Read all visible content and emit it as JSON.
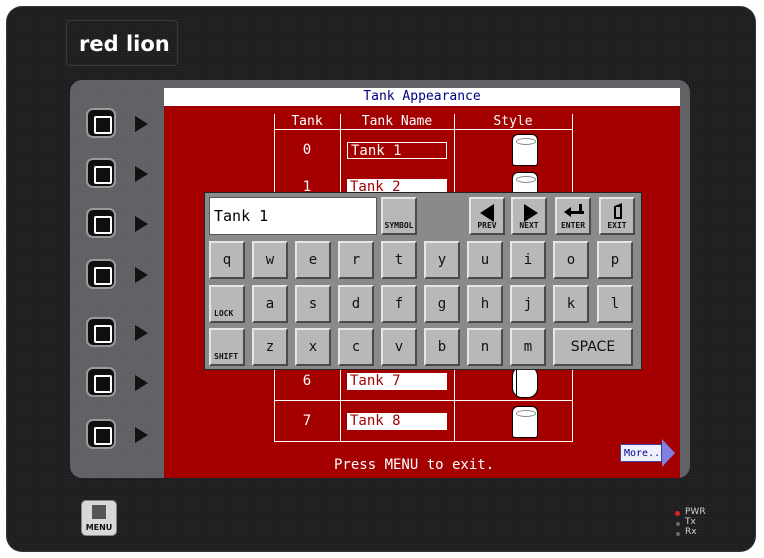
{
  "brand": {
    "logo_text": "red lion"
  },
  "screen": {
    "title": "Tank Appearance",
    "table": {
      "headers": [
        "Tank",
        "Tank Name",
        "Style"
      ],
      "rows": [
        {
          "index": "0",
          "name": "Tank 1",
          "style": "vertical-tank-icon",
          "name_style": "outline"
        },
        {
          "index": "1",
          "name": "Tank 2",
          "style": "vertical-tank-icon",
          "name_style": "filled"
        },
        {
          "index": "6",
          "name": "Tank 7",
          "style": "horizontal-tank-icon",
          "name_style": "filled"
        },
        {
          "index": "7",
          "name": "Tank 8",
          "style": "vertical-tank-icon",
          "name_style": "filled"
        }
      ]
    },
    "footer": "Press MENU to exit.",
    "more_label": "More..."
  },
  "keyboard": {
    "input_value": "Tank 1",
    "function_keys": {
      "symbol": "SYMBOL",
      "prev": "PREV",
      "next": "NEXT",
      "enter": "ENTER",
      "exit": "EXIT"
    },
    "row1": [
      "q",
      "w",
      "e",
      "r",
      "t",
      "y",
      "u",
      "i",
      "o",
      "p"
    ],
    "row2": [
      "LOCK",
      "a",
      "s",
      "d",
      "f",
      "g",
      "h",
      "j",
      "k",
      "l"
    ],
    "row3": [
      "SHIFT",
      "z",
      "x",
      "c",
      "v",
      "b",
      "n",
      "m",
      "SPACE"
    ]
  },
  "hardware": {
    "menu_label": "MENU",
    "leds": [
      {
        "label": "PWR",
        "color": "#e02020"
      },
      {
        "label": "Tx",
        "color": "#6a6a6a"
      },
      {
        "label": "Rx",
        "color": "#6a6a6a"
      }
    ]
  },
  "colors": {
    "screen_bg": "#a50000",
    "title_text": "#000080",
    "keyboard_bg": "#8a8a8a",
    "key_face": "#b8b8b8"
  }
}
